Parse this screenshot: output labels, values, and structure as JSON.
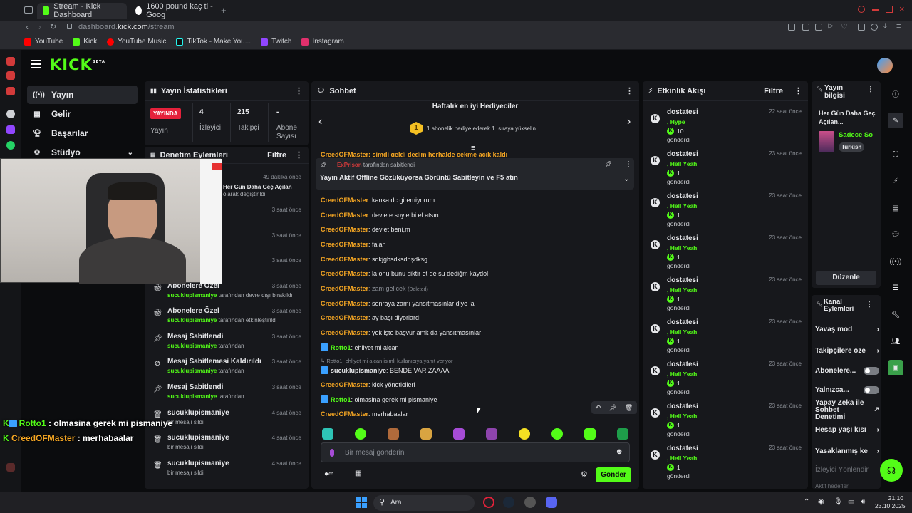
{
  "browser": {
    "tabs": [
      {
        "label": "Stream - Kick Dashboard",
        "active": true
      },
      {
        "label": "1600 pound kaç tl - Goog",
        "active": false
      }
    ],
    "url_prefix": "dashboard.",
    "url_domain": "kick.com",
    "url_path": "/stream",
    "bookmarks": [
      "YouTube",
      "Kick",
      "YouTube Music",
      "TikTok - Make You...",
      "Twitch",
      "Instagram"
    ]
  },
  "kick": {
    "logo": "KICK",
    "logo_sup": "BETA"
  },
  "nav": {
    "items": [
      {
        "label": "Yayın",
        "icon": "broadcast-icon"
      },
      {
        "label": "Gelir",
        "icon": "revenue-icon"
      },
      {
        "label": "Başarılar",
        "icon": "trophy-icon"
      },
      {
        "label": "Stüdyo",
        "icon": "studio-icon"
      }
    ]
  },
  "stats": {
    "title": "Yayın İstatistikleri",
    "live_badge": "YAYINDA",
    "live_label": "Yayın",
    "viewers_value": "4",
    "viewers_label": "İzleyici",
    "followers_value": "215",
    "followers_label": "Takipçi",
    "subs_value": "-",
    "subs_label": "Abone Sayısı"
  },
  "moderation": {
    "title": "Denetim Eylemleri",
    "filter": "Filtre",
    "top_time": "49 dakika önce",
    "top_text": "Her Gün Daha Geç Açılan",
    "top_sub": "olarak değiştirildi",
    "partial_times": [
      "3 saat önce",
      "3 saat önce",
      "3 saat önce"
    ],
    "rows": [
      {
        "title": "Abonelere Özel",
        "user": "sucuklupismaniye",
        "suffix": "tarafından devre dışı bırakıldı",
        "time": "3 saat önce",
        "icon": "gift-icon"
      },
      {
        "title": "Abonelere Özel",
        "user": "sucuklupismaniye",
        "suffix": "tarafından etkinleştirildi",
        "time": "3 saat önce",
        "icon": "gift-icon"
      },
      {
        "title": "Mesaj Sabitlendi",
        "user": "sucuklupismaniye",
        "suffix": "tarafından",
        "time": "3 saat önce",
        "icon": "pin-icon"
      },
      {
        "title": "Mesaj Sabitlemesi Kaldırıldı",
        "user": "sucuklupismaniye",
        "suffix": "tarafından",
        "time": "3 saat önce",
        "icon": "unpin-icon"
      },
      {
        "title": "Mesaj Sabitlendi",
        "user": "sucuklupismaniye",
        "suffix": "tarafından",
        "time": "3 saat önce",
        "icon": "pin-icon"
      },
      {
        "title": "sucuklupismaniye",
        "user": "",
        "suffix": "bir mesajı sildi",
        "time": "4 saat önce",
        "icon": "trash-icon"
      },
      {
        "title": "sucuklupismaniye",
        "user": "",
        "suffix": "bir mesajı sildi",
        "time": "4 saat önce",
        "icon": "trash-icon"
      },
      {
        "title": "sucuklupismaniye",
        "user": "",
        "suffix": "bir mesajı sildi",
        "time": "4 saat önce",
        "icon": "trash-icon"
      }
    ]
  },
  "overlay_chat": [
    {
      "user": "Rotto1",
      "text": " : olmasina gerek mi pismaniye"
    },
    {
      "user": "CreedOFMaster",
      "text": " : merhabaalar"
    }
  ],
  "chat": {
    "title": "Sohbet",
    "gifters_title": "Haftalık en iyi Hediyeciler",
    "gifters_rank": "1",
    "gifters_text": "1 abonelik hediye ederek 1. sıraya yükselin",
    "clipped_line": "CreedOFMaster: şimdi geldi dedim herhalde çekme açık kaldı",
    "pinned_by_user": "ExPrison",
    "pinned_by_suffix": "tarafından sabitlendi",
    "pinned_text": "Yayın Aktif Offline Gözüküyorsa Görüntü Sabitleyin ve F5 atın",
    "messages": [
      {
        "user": "CreedOFMaster",
        "text": ": kanka dc giremiyorum"
      },
      {
        "user": "CreedOFMaster",
        "text": ": devlete soyle bi el atsın"
      },
      {
        "user": "CreedOFMaster",
        "text": ": devlet beni,m"
      },
      {
        "user": "CreedOFMaster",
        "text": ": falan"
      },
      {
        "user": "CreedOFMaster",
        "text": ": sdkjgbsdksdnşdksg"
      },
      {
        "user": "CreedOFMaster",
        "text": ": la onu bunu siktir et de su dediğm kaydol"
      },
      {
        "user": "CreedOFMaster",
        "text": ": zam gelicek",
        "deleted": "(Deleted)"
      },
      {
        "user": "CreedOFMaster",
        "text": ": sonraya zamı yansıtmasınlar diye la"
      },
      {
        "user": "CreedOFMaster",
        "text": ": ay başı diyorlardı"
      },
      {
        "user": "CreedOFMaster",
        "text": ": yok işte başvur amk da yansıtmasınlar"
      },
      {
        "user": "Rotto1",
        "text": ": ehliyet mi alcan",
        "sub": true
      },
      {
        "reply": "Rotto1: ehliyet mi alcan isimli kullanıcıya yanıt veriyor"
      },
      {
        "user": "sucuklupismaniye",
        "text": ": BENDE VAR ZAAAA",
        "sub": true,
        "white": true
      },
      {
        "user": "CreedOFMaster",
        "text": ": kick yöneticileri"
      },
      {
        "user": "Rotto1",
        "text": ": olmasina gerek mi pismaniye",
        "sub": true
      },
      {
        "user": "CreedOFMaster",
        "text": ": merhabaalar"
      }
    ],
    "input_placeholder": "Bir mesaj gönderin",
    "send_label": "Gönder"
  },
  "activity": {
    "title": "Etkinlik Akışı",
    "filter": "Filtre",
    "items": [
      {
        "user": "dostatesi",
        "tier": ", Hype",
        "count": "10",
        "sent": "gönderdi",
        "time": "22 saat önce"
      },
      {
        "user": "dostatesi",
        "tier": ", Hell Yeah",
        "count": "1",
        "sent": "gönderdi",
        "time": "23 saat önce"
      },
      {
        "user": "dostatesi",
        "tier": ", Hell Yeah",
        "count": "1",
        "sent": "gönderdi",
        "time": "23 saat önce"
      },
      {
        "user": "dostatesi",
        "tier": ", Hell Yeah",
        "count": "1",
        "sent": "gönderdi",
        "time": "23 saat önce"
      },
      {
        "user": "dostatesi",
        "tier": ", Hell Yeah",
        "count": "1",
        "sent": "gönderdi",
        "time": "23 saat önce"
      },
      {
        "user": "dostatesi",
        "tier": ", Hell Yeah",
        "count": "1",
        "sent": "gönderdi",
        "time": "23 saat önce"
      },
      {
        "user": "dostatesi",
        "tier": ", Hell Yeah",
        "count": "1",
        "sent": "gönderdi",
        "time": "23 saat önce"
      },
      {
        "user": "dostatesi",
        "tier": ", Hell Yeah",
        "count": "1",
        "sent": "gönderdi",
        "time": "23 saat önce"
      },
      {
        "user": "dostatesi",
        "tier": ", Hell Yeah",
        "count": "1",
        "sent": "gönderdi",
        "time": "23 saat önce"
      }
    ]
  },
  "stream_info": {
    "title": "Yayın bilgisi",
    "stream_title": "Her Gün Daha Geç Açılan...",
    "category": "Sadece So",
    "language": "Turkish",
    "edit_label": "Düzenle"
  },
  "channel_actions": {
    "title": "Kanal Eylemleri",
    "items": [
      {
        "label": "Yavaş mod",
        "control": "chevron"
      },
      {
        "label": "Takipçilere öze",
        "control": "chevron"
      },
      {
        "label": "Abonelere...",
        "control": "toggle"
      },
      {
        "label": "Yalnızca...",
        "control": "toggle"
      },
      {
        "label": "Yapay Zeka ile Sohbet Denetimi",
        "control": "external"
      },
      {
        "label": "Hesap yaşı kısı",
        "control": "chevron"
      },
      {
        "label": "Yasaklanmış ke",
        "control": "chevron"
      },
      {
        "label": "İzleyici Yönlendir",
        "control": "none"
      },
      {
        "label": "Aktif hedefler",
        "control": "none"
      }
    ]
  },
  "taskbar": {
    "search": "Ara",
    "time": "21:10",
    "date": "23.10.2025"
  },
  "colors": {
    "kick_green": "#53fc18",
    "live_red": "#e5213b",
    "chat_user": "#f5a623"
  }
}
